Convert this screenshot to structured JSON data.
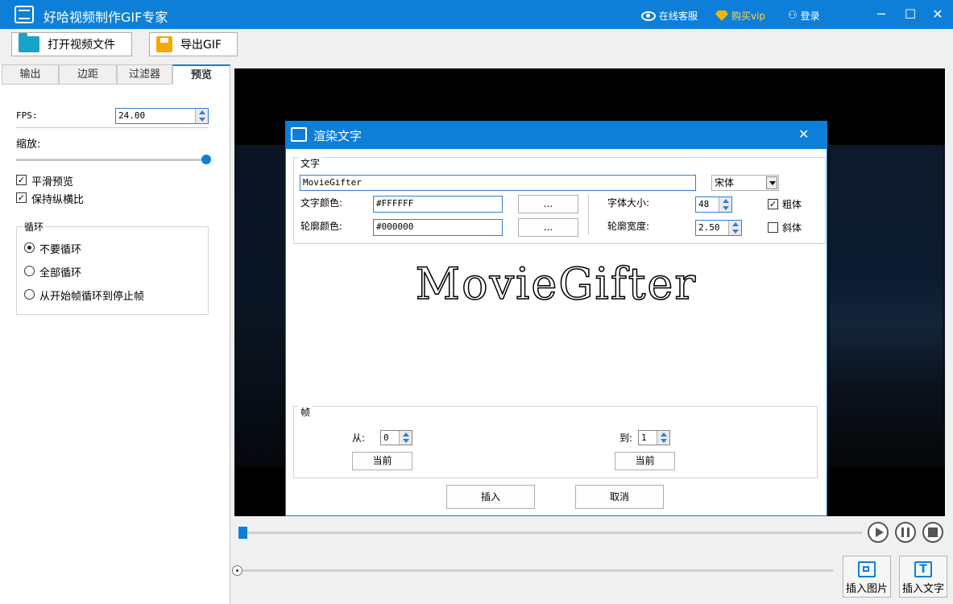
{
  "window": {
    "title": "好哈视频制作GIF专家",
    "online_service": "在线客服",
    "buy_vip": "购买vip",
    "login": "登录",
    "minimize": "─",
    "maximize": "☐",
    "close": "✕"
  },
  "toolbar": {
    "open_video": "打开视频文件",
    "export_gif": "导出GIF"
  },
  "tabs": [
    "输出",
    "边距",
    "过滤器",
    "预览"
  ],
  "preview": {
    "fps_label": "FPS:",
    "fps_value": "24.00",
    "zoom_label": "缩放:",
    "zoom_level": 1.0,
    "smooth_preview": "平滑预览",
    "smooth_checked": true,
    "keep_ratio": "保持纵横比",
    "keep_ratio_checked": true,
    "loop_group": "循环",
    "loop_options": [
      "不要循环",
      "全部循环",
      "从开始帧循环到停止帧"
    ],
    "loop_selected": 0
  },
  "dialog": {
    "title": "渲染文字",
    "close": "✕",
    "text_group": "文字",
    "text_value": "MovieGifter",
    "font_name": "宋体",
    "text_color_label": "文字颜色:",
    "text_color_value": "#FFFFFF",
    "outline_color_label": "轮廓颜色:",
    "outline_color_value": "#000000",
    "pick_button": "...",
    "font_size_label": "字体大小:",
    "font_size_value": "48",
    "outline_width_label": "轮廓宽度:",
    "outline_width_value": "2.50",
    "bold_label": "粗体",
    "bold_checked": true,
    "italic_label": "斜体",
    "italic_checked": false,
    "preview_text": "MovieGifter",
    "frame_group": "帧",
    "from_label": "从:",
    "from_value": "0",
    "to_label": "到:",
    "to_value": "1",
    "current_button": "当前",
    "insert_button": "插入",
    "cancel_button": "取消"
  },
  "player": {
    "progress": 0.0,
    "play_icon": "play-icon",
    "pause_icon": "pause-icon",
    "stop_icon": "stop-icon",
    "insert_image": "插入图片",
    "insert_text": "插入文字"
  },
  "colors": {
    "accent": "#0d7fd8",
    "video_bg": "#000000"
  }
}
